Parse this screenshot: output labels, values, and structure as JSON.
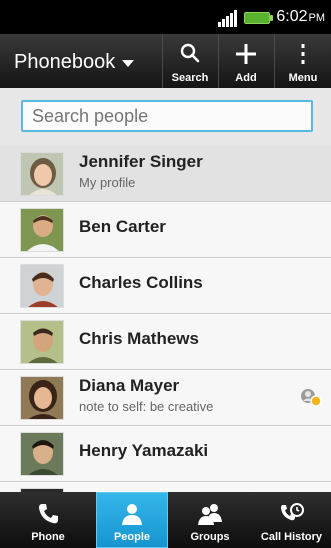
{
  "status": {
    "time": "6:02",
    "ampm": "PM"
  },
  "header": {
    "title": "Phonebook",
    "actions": [
      {
        "label": "Search",
        "icon": "search-icon"
      },
      {
        "label": "Add",
        "icon": "plus-icon"
      },
      {
        "label": "Menu",
        "icon": "more-vert-icon"
      }
    ]
  },
  "search": {
    "placeholder": "Search people",
    "value": ""
  },
  "contacts": [
    {
      "name": "Jennifer Singer",
      "subtitle": "My profile",
      "selected": true
    },
    {
      "name": "Ben Carter"
    },
    {
      "name": "Charles Collins"
    },
    {
      "name": "Chris Mathews"
    },
    {
      "name": "Diana Mayer",
      "subtitle": "note to self: be creative",
      "status_icon": "presence-icon"
    },
    {
      "name": "Henry Yamazaki"
    }
  ],
  "bottom_nav": [
    {
      "label": "Phone",
      "icon": "phone-icon"
    },
    {
      "label": "People",
      "icon": "person-icon",
      "active": true
    },
    {
      "label": "Groups",
      "icon": "group-icon"
    },
    {
      "label": "Call History",
      "icon": "call-history-icon"
    }
  ],
  "colors": {
    "accent": "#24A8E0",
    "header_bg": "#1a1a1a",
    "list_bg": "#F7F7F7"
  }
}
